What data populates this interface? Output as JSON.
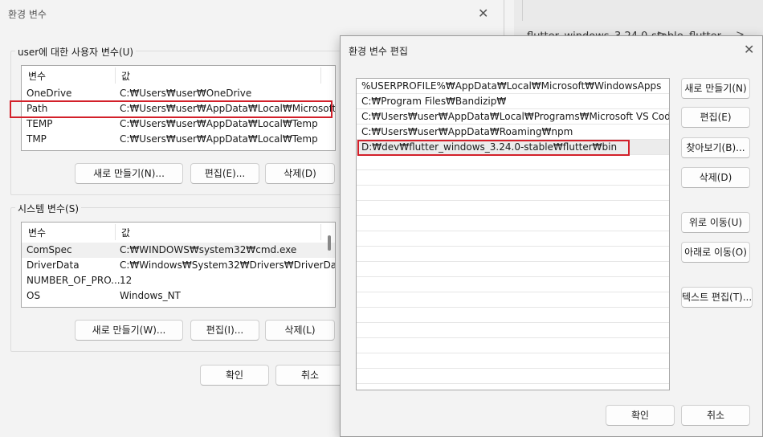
{
  "background": {
    "address_parts": [
      "flutter_windows_3.24.0-stable",
      "flutter"
    ],
    "separator": ">"
  },
  "env_dialog": {
    "title": "환경 변수",
    "user_group": {
      "label": "user에 대한 사용자 변수(U)",
      "col_var": "변수",
      "col_val": "값",
      "rows": [
        {
          "name": "OneDrive",
          "value": "C:₩Users₩user₩OneDrive"
        },
        {
          "name": "Path",
          "value": "C:₩Users₩user₩AppData₩Local₩Microsoft..."
        },
        {
          "name": "TEMP",
          "value": "C:₩Users₩user₩AppData₩Local₩Temp"
        },
        {
          "name": "TMP",
          "value": "C:₩Users₩user₩AppData₩Local₩Temp"
        }
      ],
      "buttons": {
        "new": "새로 만들기(N)...",
        "edit": "편집(E)...",
        "delete": "삭제(D)"
      }
    },
    "system_group": {
      "label": "시스템 변수(S)",
      "col_var": "변수",
      "col_val": "값",
      "rows": [
        {
          "name": "ComSpec",
          "value": "C:₩WINDOWS₩system32₩cmd.exe"
        },
        {
          "name": "DriverData",
          "value": "C:₩Windows₩System32₩Drivers₩DriverData"
        },
        {
          "name": "NUMBER_OF_PRO...",
          "value": "12"
        },
        {
          "name": "OS",
          "value": "Windows_NT"
        }
      ],
      "buttons": {
        "new": "새로 만들기(W)...",
        "edit": "편집(I)...",
        "delete": "삭제(L)"
      }
    },
    "ok": "확인",
    "cancel": "취소"
  },
  "edit_dialog": {
    "title": "환경 변수 편집",
    "paths": [
      "%USERPROFILE%₩AppData₩Local₩Microsoft₩WindowsApps",
      "C:₩Program Files₩Bandizip₩",
      "C:₩Users₩user₩AppData₩Local₩Programs₩Microsoft VS Code₩bin",
      "C:₩Users₩user₩AppData₩Roaming₩npm",
      "D:₩dev₩flutter_windows_3.24.0-stable₩flutter₩bin"
    ],
    "buttons": {
      "new": "새로 만들기(N)",
      "edit": "편집(E)",
      "browse": "찾아보기(B)...",
      "delete": "삭제(D)",
      "move_up": "위로 이동(U)",
      "move_down": "아래로 이동(O)",
      "edit_text": "텍스트 편집(T)..."
    },
    "ok": "확인",
    "cancel": "취소"
  },
  "colors": {
    "highlight_box": "#d3202a"
  }
}
